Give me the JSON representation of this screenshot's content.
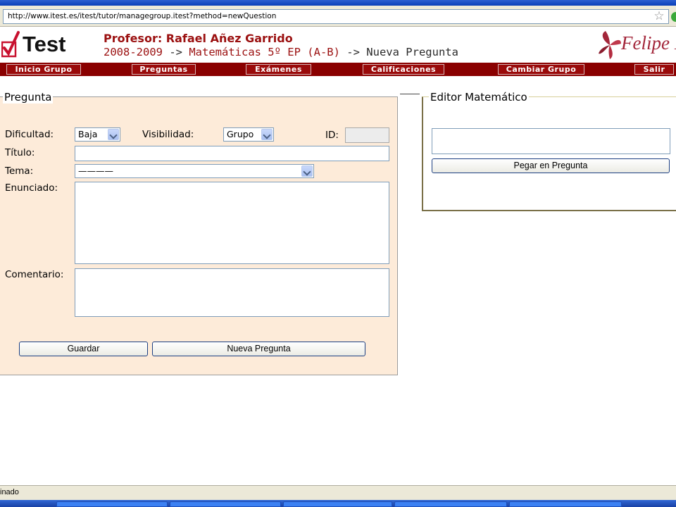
{
  "browser": {
    "url": "http://www.itest.es/itest/tutor/managegroup.itest?method=newQuestion",
    "status": "inado"
  },
  "header": {
    "logo_text": "Test",
    "professor": "Profesor: Rafael Añez Garrido",
    "crumb_year": "2008-2009",
    "crumb_arrow1": " -> ",
    "crumb_group": "Matemáticas 5º EP (A-B)",
    "crumb_arrow2": " -> ",
    "crumb_page": "Nueva Pregunta",
    "brand": "Felipe II"
  },
  "nav": {
    "inicio": "Inicio Grupo",
    "preguntas": "Preguntas",
    "examenes": "Exámenes",
    "calificaciones": "Calificaciones",
    "cambiar": "Cambiar Grupo",
    "salir": "Salir"
  },
  "pregunta": {
    "legend": "Pregunta",
    "dificultad_label": "Dificultad:",
    "dificultad_value": "Baja",
    "visibilidad_label": "Visibilidad:",
    "visibilidad_value": "Grupo",
    "id_label": "ID:",
    "titulo_label": "Título:",
    "tema_label": "Tema:",
    "tema_value": "————",
    "enunciado_label": "Enunciado:",
    "comentario_label": "Comentario:",
    "guardar": "Guardar",
    "nueva": "Nueva Pregunta"
  },
  "editor": {
    "legend": "Editor Matemático",
    "pegar": "Pegar en Pregunta"
  },
  "colors": {
    "nav_bg": "#8a0000",
    "form_bg": "#fdebd9",
    "header_red": "#9b1010"
  }
}
